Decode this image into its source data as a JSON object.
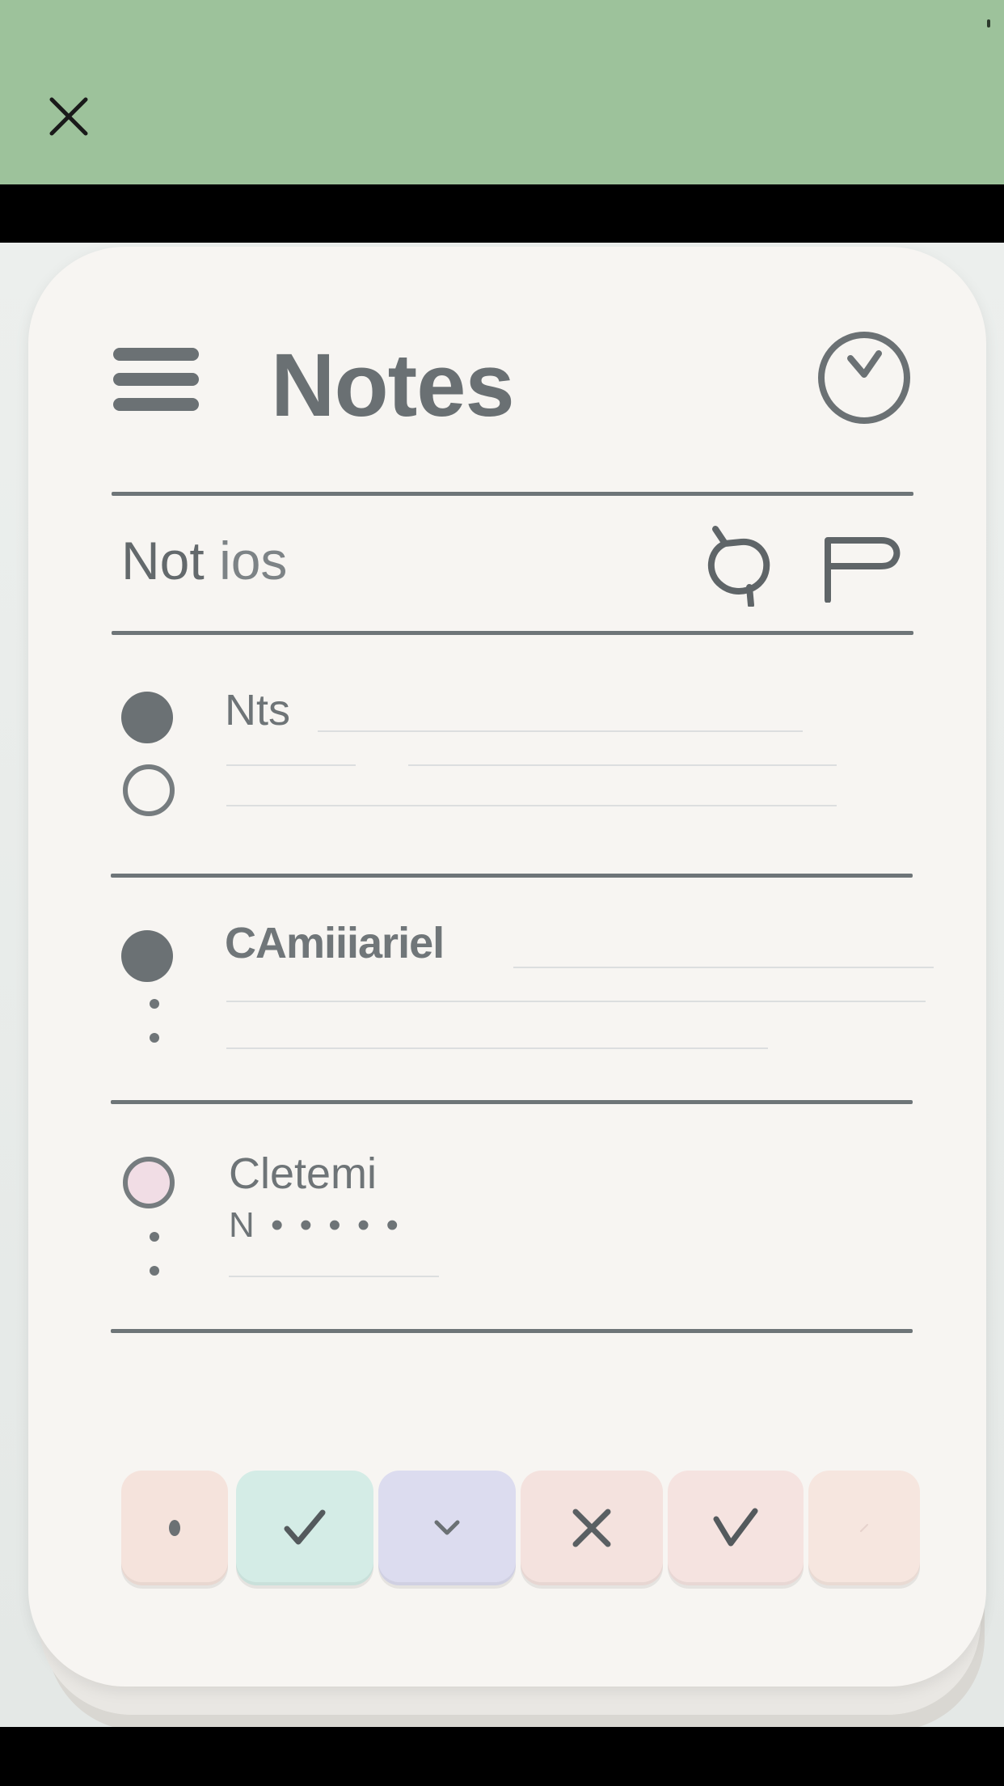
{
  "app": {
    "title": "Notes"
  },
  "toolbar": {
    "close_icon": "close-icon",
    "clock_icon": "clock-icon",
    "menu_icon": "hamburger-menu-icon"
  },
  "section": {
    "title_part1": "Not",
    "title_part2": "ios",
    "icons": [
      "loop-icon",
      "flag-icon"
    ]
  },
  "notes": [
    {
      "title": "Nts",
      "meta": ""
    },
    {
      "title": "CAmiiiariel",
      "meta": ""
    },
    {
      "title": "Cletemi",
      "meta": "N • • • • •"
    }
  ],
  "actions": [
    {
      "name": "dot-action",
      "icon": "dot-icon",
      "color": "#f5e3dc"
    },
    {
      "name": "check-action-teal",
      "icon": "check-icon",
      "color": "#d4ece6"
    },
    {
      "name": "chevron-action",
      "icon": "chevron-down-icon",
      "color": "#dcdcef"
    },
    {
      "name": "delete-action",
      "icon": "x-icon",
      "color": "#f4e2de"
    },
    {
      "name": "check-action-pink",
      "icon": "check-icon",
      "color": "#f5e3e0"
    },
    {
      "name": "blank-action",
      "icon": "blank",
      "color": "#f6e6df"
    }
  ],
  "colors": {
    "topbar": "#9dc29b",
    "card": "#f7f5f2",
    "ink": "#6b7174"
  }
}
